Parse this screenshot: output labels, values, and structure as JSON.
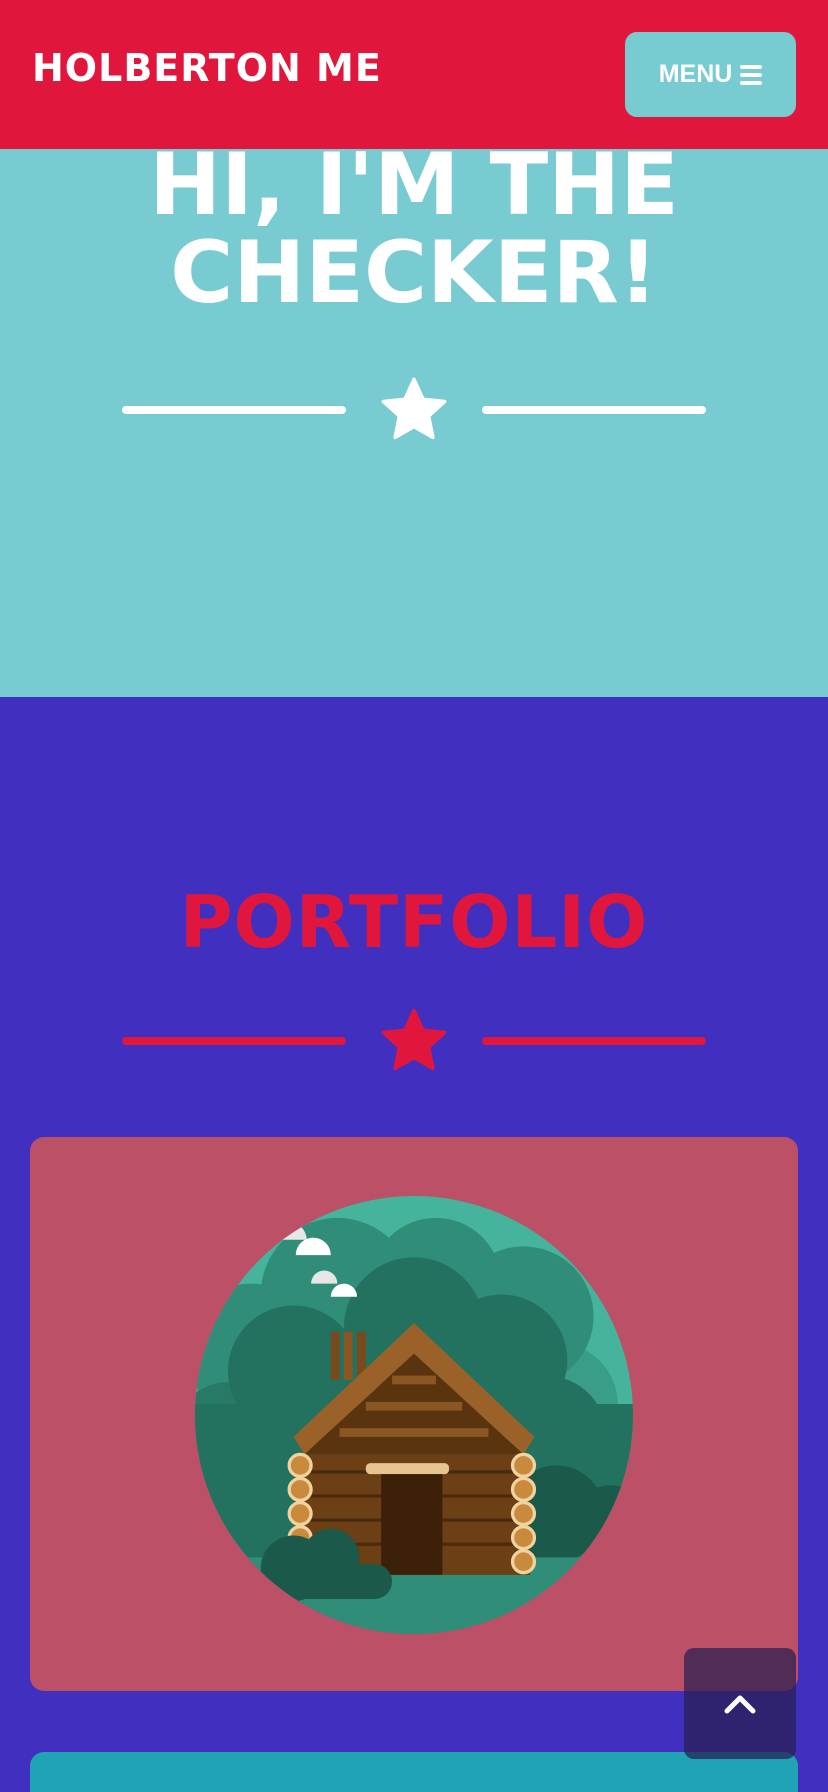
{
  "navbar": {
    "brand": "HOLBERTON ME",
    "menu_label": "MENU",
    "menu_icon": "hamburger-icon"
  },
  "hero": {
    "title": "HI, I'M THE CHECKER!",
    "star_icon": "star-icon"
  },
  "portfolio": {
    "title": "PORTFOLIO",
    "star_icon": "star-icon",
    "items": [
      {
        "image": "log-cabin-illustration"
      }
    ]
  },
  "scroll_top": {
    "icon": "chevron-up-icon"
  },
  "colors": {
    "navbar": "#e0163d",
    "hero_bg": "#78cbd0",
    "page_bg": "#4130c0",
    "card_bg": "#bb5066",
    "card2_bg": "#21a3b6",
    "accent_red": "#e0163d"
  }
}
